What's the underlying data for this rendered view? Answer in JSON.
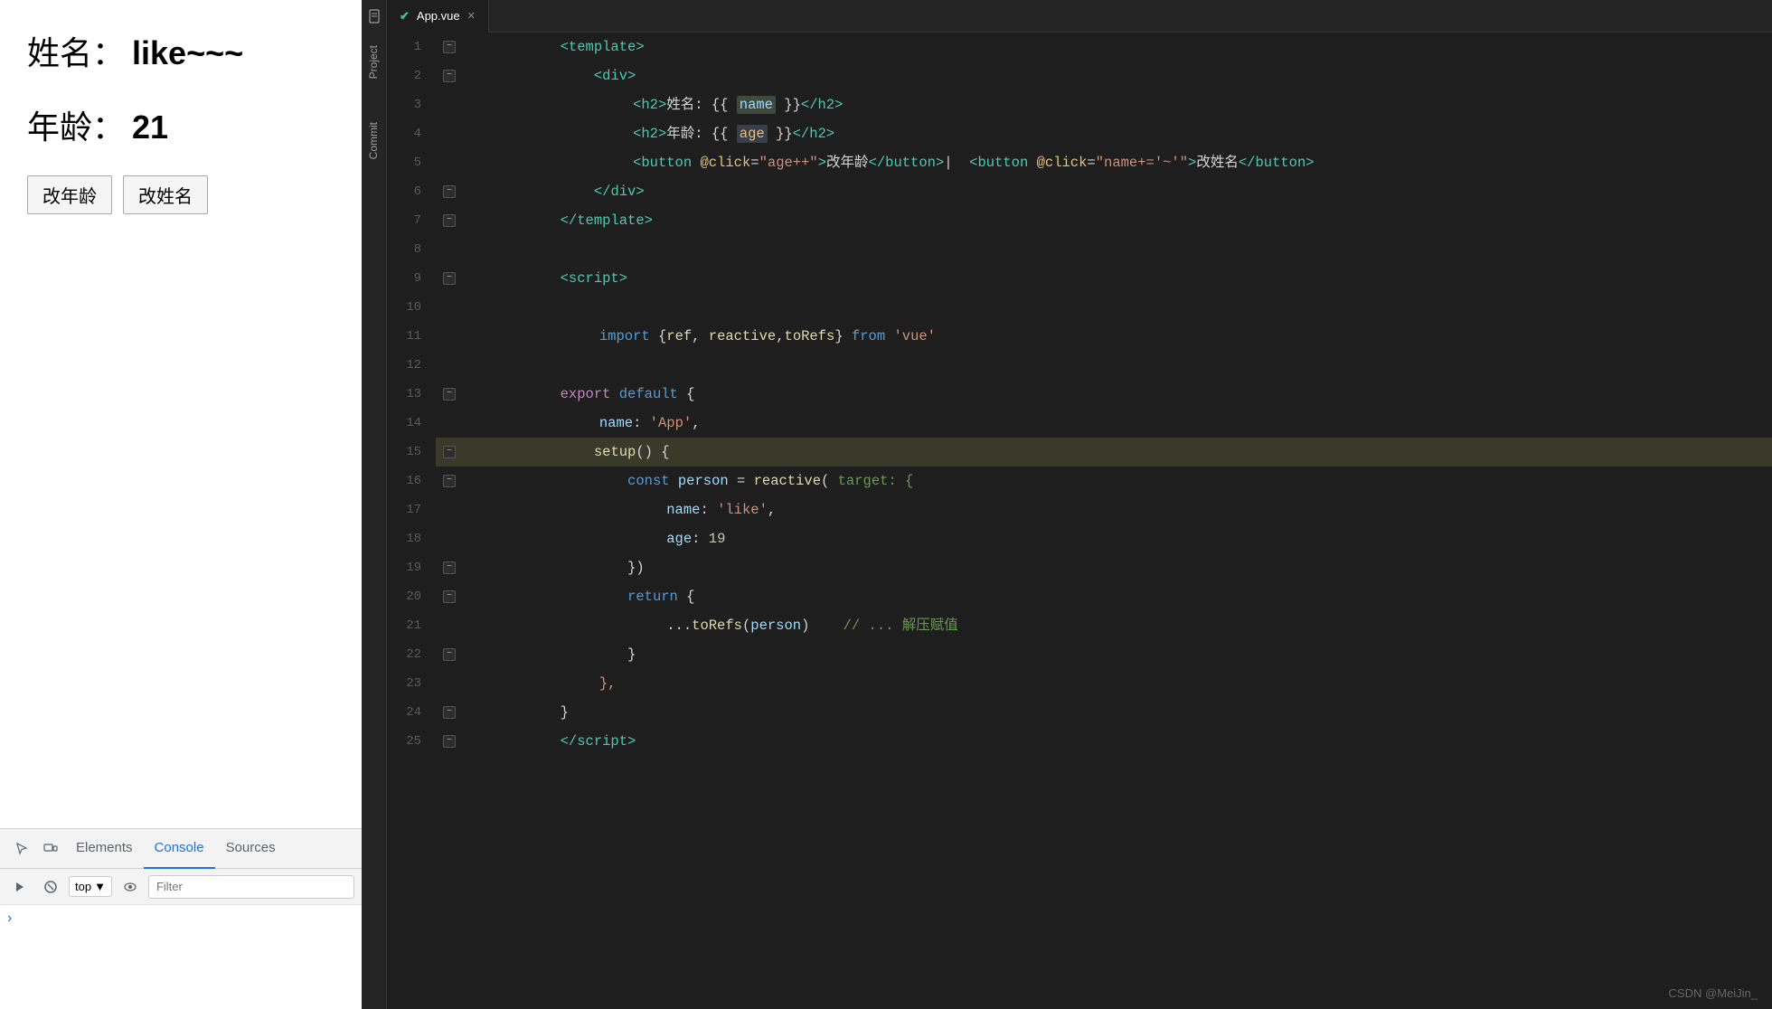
{
  "preview": {
    "name_label": "姓名：",
    "name_value": "like~~~",
    "age_label": "年龄：",
    "age_value": "21",
    "btn_age": "改年龄",
    "btn_name": "改姓名"
  },
  "devtools": {
    "tabs": [
      "Elements",
      "Console",
      "Sources"
    ],
    "active_tab": "Console",
    "top_label": "top",
    "filter_placeholder": "Filter",
    "console_prompt": "›"
  },
  "sidebar": {
    "tab_project": "Project",
    "tab_commit": "Commit"
  },
  "editor": {
    "tab_name": "App.vue",
    "tab_icon": "✔",
    "watermark": "CSDN @MeiJin_"
  }
}
